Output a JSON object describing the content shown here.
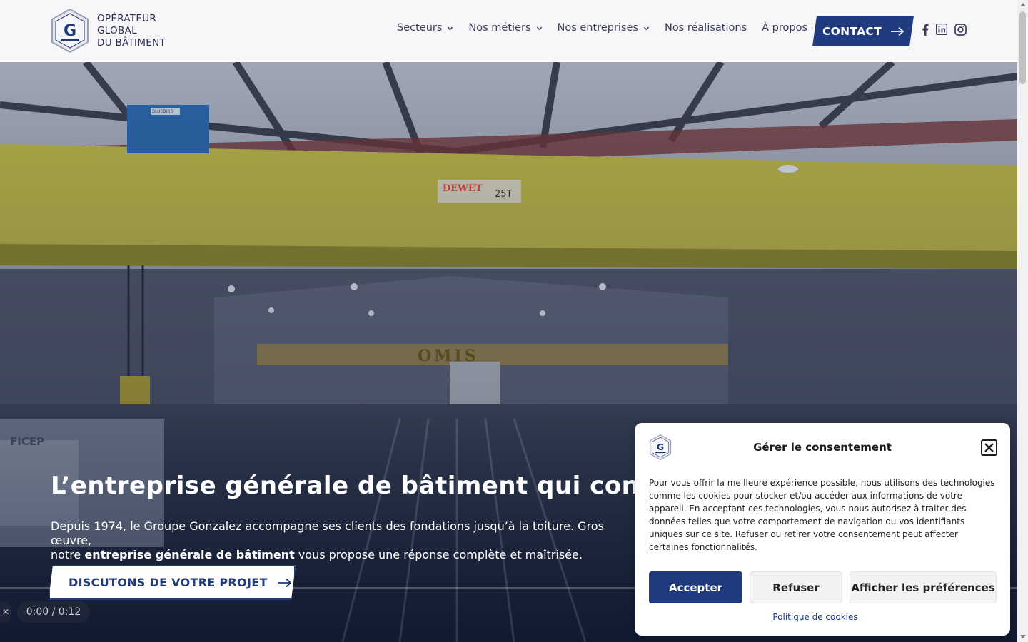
{
  "header": {
    "logo_lines": [
      "OPÉRATEUR",
      "GLOBAL",
      "DU BÂTIMENT"
    ],
    "nav": [
      {
        "label": "Secteurs",
        "dropdown": true
      },
      {
        "label": "Nos métiers",
        "dropdown": true
      },
      {
        "label": "Nos entreprises",
        "dropdown": true
      },
      {
        "label": "Nos réalisations",
        "dropdown": false
      },
      {
        "label": "À propos",
        "dropdown": false
      }
    ],
    "contact_label": "CONTACT",
    "social": [
      "facebook-icon",
      "linkedin-icon",
      "instagram-icon"
    ]
  },
  "hero": {
    "title": "L’entreprise générale de bâtiment qui construit",
    "desc_line1": "Depuis 1974, le Groupe Gonzalez accompagne ses clients des fondations jusqu’à la toiture. Gros œuvre,",
    "desc_line2_pre": "notre ",
    "desc_line2_bold": "entreprise générale de bâtiment",
    "desc_line2_post": " vous propose une réponse complète et maîtrisée.",
    "cta_label": "DISCUTONS DE VOTRE PROJET",
    "video_time": "0:00 / 0:12",
    "video_close": "✕",
    "scene_texts": {
      "crane_brand": "DEWET",
      "crane_capacity": "25T",
      "sign": "OMIS",
      "machine_brand": "FICEP",
      "equipment_label": "BLUEBIRD"
    }
  },
  "consent": {
    "title": "Gérer le consentement",
    "text": "Pour vous offrir la meilleure expérience possible, nous utilisons des technologies comme les cookies pour stocker et/ou accéder aux informations de votre appareil. En acceptant ces technologies, vous nous autorisez à traiter des données telles que votre comportement de navigation ou vos identifiants uniques sur ce site. Refuser ou retirer votre consentement peut affecter certaines fonctionnalités.",
    "accept": "Accepter",
    "refuse": "Refuser",
    "preferences": "Afficher les préférences",
    "policy_link": "Politique de cookies"
  },
  "colors": {
    "brand": "#1f3a7e",
    "header_bg": "#f7f7f9"
  }
}
